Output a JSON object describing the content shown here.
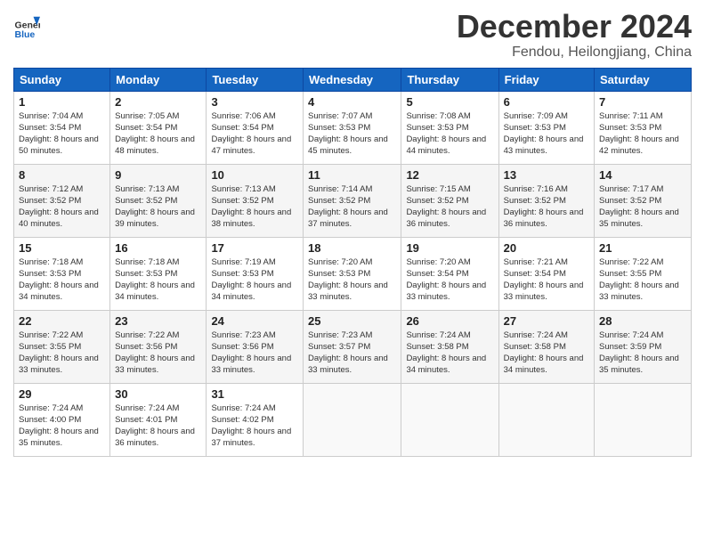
{
  "header": {
    "logo_line1": "General",
    "logo_line2": "Blue",
    "month": "December 2024",
    "location": "Fendou, Heilongjiang, China"
  },
  "weekdays": [
    "Sunday",
    "Monday",
    "Tuesday",
    "Wednesday",
    "Thursday",
    "Friday",
    "Saturday"
  ],
  "weeks": [
    [
      {
        "day": "1",
        "sunrise": "7:04 AM",
        "sunset": "3:54 PM",
        "daylight": "8 hours and 50 minutes."
      },
      {
        "day": "2",
        "sunrise": "7:05 AM",
        "sunset": "3:54 PM",
        "daylight": "8 hours and 48 minutes."
      },
      {
        "day": "3",
        "sunrise": "7:06 AM",
        "sunset": "3:54 PM",
        "daylight": "8 hours and 47 minutes."
      },
      {
        "day": "4",
        "sunrise": "7:07 AM",
        "sunset": "3:53 PM",
        "daylight": "8 hours and 45 minutes."
      },
      {
        "day": "5",
        "sunrise": "7:08 AM",
        "sunset": "3:53 PM",
        "daylight": "8 hours and 44 minutes."
      },
      {
        "day": "6",
        "sunrise": "7:09 AM",
        "sunset": "3:53 PM",
        "daylight": "8 hours and 43 minutes."
      },
      {
        "day": "7",
        "sunrise": "7:11 AM",
        "sunset": "3:53 PM",
        "daylight": "8 hours and 42 minutes."
      }
    ],
    [
      {
        "day": "8",
        "sunrise": "7:12 AM",
        "sunset": "3:52 PM",
        "daylight": "8 hours and 40 minutes."
      },
      {
        "day": "9",
        "sunrise": "7:13 AM",
        "sunset": "3:52 PM",
        "daylight": "8 hours and 39 minutes."
      },
      {
        "day": "10",
        "sunrise": "7:13 AM",
        "sunset": "3:52 PM",
        "daylight": "8 hours and 38 minutes."
      },
      {
        "day": "11",
        "sunrise": "7:14 AM",
        "sunset": "3:52 PM",
        "daylight": "8 hours and 37 minutes."
      },
      {
        "day": "12",
        "sunrise": "7:15 AM",
        "sunset": "3:52 PM",
        "daylight": "8 hours and 36 minutes."
      },
      {
        "day": "13",
        "sunrise": "7:16 AM",
        "sunset": "3:52 PM",
        "daylight": "8 hours and 36 minutes."
      },
      {
        "day": "14",
        "sunrise": "7:17 AM",
        "sunset": "3:52 PM",
        "daylight": "8 hours and 35 minutes."
      }
    ],
    [
      {
        "day": "15",
        "sunrise": "7:18 AM",
        "sunset": "3:53 PM",
        "daylight": "8 hours and 34 minutes."
      },
      {
        "day": "16",
        "sunrise": "7:18 AM",
        "sunset": "3:53 PM",
        "daylight": "8 hours and 34 minutes."
      },
      {
        "day": "17",
        "sunrise": "7:19 AM",
        "sunset": "3:53 PM",
        "daylight": "8 hours and 34 minutes."
      },
      {
        "day": "18",
        "sunrise": "7:20 AM",
        "sunset": "3:53 PM",
        "daylight": "8 hours and 33 minutes."
      },
      {
        "day": "19",
        "sunrise": "7:20 AM",
        "sunset": "3:54 PM",
        "daylight": "8 hours and 33 minutes."
      },
      {
        "day": "20",
        "sunrise": "7:21 AM",
        "sunset": "3:54 PM",
        "daylight": "8 hours and 33 minutes."
      },
      {
        "day": "21",
        "sunrise": "7:22 AM",
        "sunset": "3:55 PM",
        "daylight": "8 hours and 33 minutes."
      }
    ],
    [
      {
        "day": "22",
        "sunrise": "7:22 AM",
        "sunset": "3:55 PM",
        "daylight": "8 hours and 33 minutes."
      },
      {
        "day": "23",
        "sunrise": "7:22 AM",
        "sunset": "3:56 PM",
        "daylight": "8 hours and 33 minutes."
      },
      {
        "day": "24",
        "sunrise": "7:23 AM",
        "sunset": "3:56 PM",
        "daylight": "8 hours and 33 minutes."
      },
      {
        "day": "25",
        "sunrise": "7:23 AM",
        "sunset": "3:57 PM",
        "daylight": "8 hours and 33 minutes."
      },
      {
        "day": "26",
        "sunrise": "7:24 AM",
        "sunset": "3:58 PM",
        "daylight": "8 hours and 34 minutes."
      },
      {
        "day": "27",
        "sunrise": "7:24 AM",
        "sunset": "3:58 PM",
        "daylight": "8 hours and 34 minutes."
      },
      {
        "day": "28",
        "sunrise": "7:24 AM",
        "sunset": "3:59 PM",
        "daylight": "8 hours and 35 minutes."
      }
    ],
    [
      {
        "day": "29",
        "sunrise": "7:24 AM",
        "sunset": "4:00 PM",
        "daylight": "8 hours and 35 minutes."
      },
      {
        "day": "30",
        "sunrise": "7:24 AM",
        "sunset": "4:01 PM",
        "daylight": "8 hours and 36 minutes."
      },
      {
        "day": "31",
        "sunrise": "7:24 AM",
        "sunset": "4:02 PM",
        "daylight": "8 hours and 37 minutes."
      },
      null,
      null,
      null,
      null
    ]
  ]
}
